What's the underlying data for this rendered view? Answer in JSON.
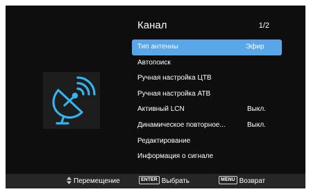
{
  "header": {
    "title": "Канал",
    "page": "1/2"
  },
  "menu": {
    "items": [
      {
        "label": "Тип антенны",
        "value": "Эфир",
        "selected": true
      },
      {
        "label": "Автопоиск",
        "value": ""
      },
      {
        "label": "Ручная настройка ЦТВ",
        "value": ""
      },
      {
        "label": "Ручная настройка АТВ",
        "value": ""
      },
      {
        "label": "Активный  LCN",
        "value": "Выкл."
      },
      {
        "label": "Динамическое повторное...",
        "value": "Выкл."
      },
      {
        "label": "Редактирование",
        "value": ""
      },
      {
        "label": "Информация о сигнале",
        "value": ""
      }
    ]
  },
  "footer": {
    "move_label": "Перемещение",
    "enter_key": "ENTER",
    "select_label": "Выбрать",
    "menu_key": "MENU",
    "back_label": "Возврат"
  },
  "icon": {
    "name": "satellite-dish-icon",
    "color": "#33b5f0"
  },
  "colors": {
    "highlight": "#58a6e8",
    "background": "#0e0e0e",
    "footer": "#262626"
  }
}
